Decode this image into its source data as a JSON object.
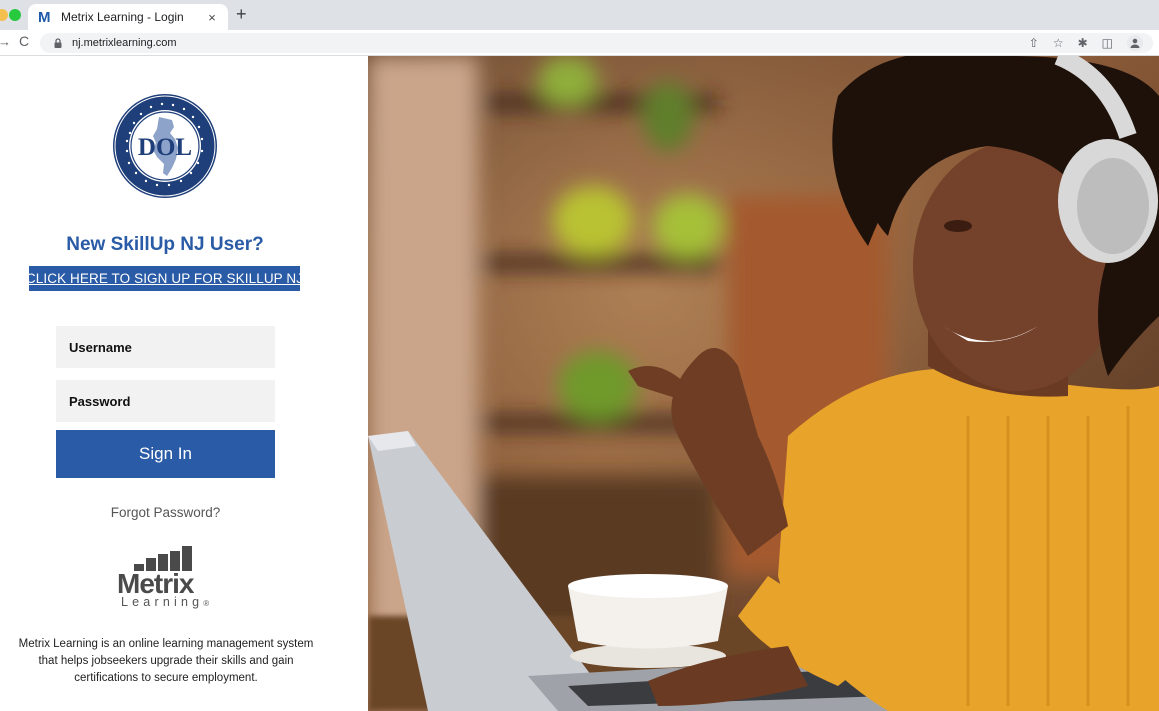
{
  "browser": {
    "tab": {
      "title": "Metrix Learning - Login",
      "favicon_letter": "M",
      "close_icon": "×"
    },
    "new_tab_icon": "+",
    "url": "nj.metrixlearning.com",
    "nav_icons": {
      "forward": "→",
      "reload": "C"
    },
    "actions": {
      "share": "⇧",
      "bookmark": "☆",
      "extensions": "✱",
      "sidebar": "◫"
    }
  },
  "login": {
    "seal_label": "DOL",
    "heading": "New SkillUp NJ User?",
    "signup_link": "CLICK HERE TO SIGN UP FOR SKILLUP NJ",
    "username_placeholder": "Username",
    "password_placeholder": "Password",
    "signin_label": "Sign In",
    "forgot_label": "Forgot Password?",
    "logo_word": "Metrix",
    "logo_sub": "Learning",
    "logo_reg": "®",
    "description": "Metrix Learning is an online learning management system that helps jobseekers upgrade their skills and gain certifications to secure employment."
  },
  "colors": {
    "brand_blue": "#2a5ba6",
    "field_bg": "#f2f2f2",
    "tabbar_bg": "#dee1e6"
  }
}
